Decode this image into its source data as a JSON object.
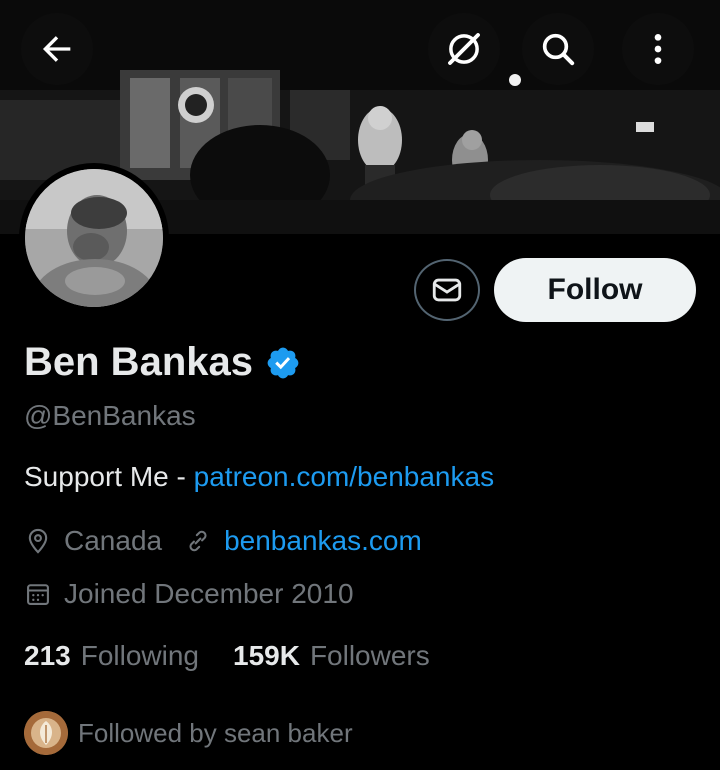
{
  "header": {
    "back_icon": "arrow-left-icon",
    "grok_icon": "grok-icon",
    "search_icon": "search-icon",
    "more_icon": "more-vertical-icon"
  },
  "profile": {
    "name": "Ben Bankas",
    "verified": true,
    "handle": "@BenBankas",
    "bio_prefix": "Support Me - ",
    "bio_link": "patreon.com/benbankas",
    "location": "Canada",
    "website": "benbankas.com",
    "joined": "Joined December 2010"
  },
  "actions": {
    "message_icon": "mail-icon",
    "follow_label": "Follow"
  },
  "stats": {
    "following_count": "213",
    "following_label": "Following",
    "followers_count": "159K",
    "followers_label": "Followers"
  },
  "followed_by": {
    "text": "Followed by sean baker"
  },
  "colors": {
    "background": "#000000",
    "link": "#1d9bf0",
    "secondary_text": "#71767b",
    "primary_text": "#e7e9ea",
    "verified_badge": "#1d9bf0"
  }
}
